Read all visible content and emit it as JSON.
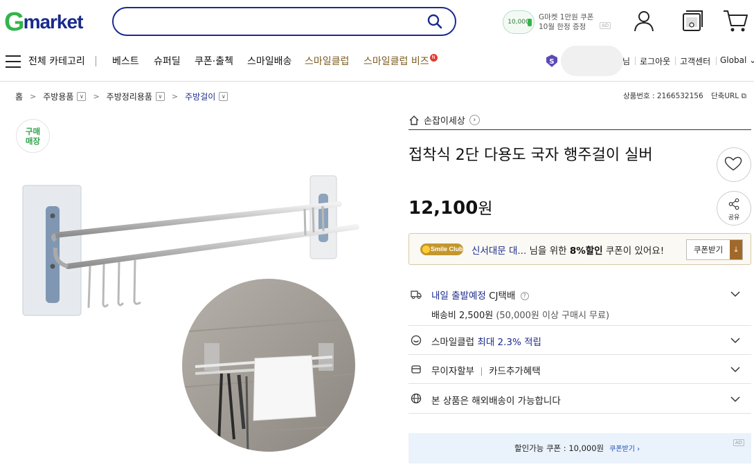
{
  "header": {
    "logo_g": "G",
    "logo_rest": "market",
    "search_value": "",
    "promo_badge": "10,000",
    "promo_line1": "G마켓 1만원 쿠폰",
    "promo_line2": "10월 한정 증정",
    "promo_ad": "AD"
  },
  "nav": {
    "all_categories": "전체 카테고리",
    "items": [
      "베스트",
      "슈퍼딜",
      "쿠폰·출첵",
      "스마일배송"
    ],
    "gold_items": [
      "스마일클럽",
      "스마일클럽 비즈"
    ],
    "new_badge": "N",
    "user_suffix": "님",
    "logout": "로그아웃",
    "customer_center": "고객센터",
    "global": "Global",
    "global_caret": "⌄"
  },
  "breadcrumb": {
    "home": "홈",
    "items": [
      "주방용품",
      "주방정리용품",
      "주방걸이"
    ],
    "product_no": "상품번호 : 2166532156",
    "short_url": "단축URL"
  },
  "product": {
    "buy_badge_line1": "구매",
    "buy_badge_line2": "매장",
    "seller": "손잡이세상",
    "title": "접착식 2단 다용도 국자 행주걸이 실버",
    "price_number": "12,100",
    "price_unit": "원",
    "share_label": "공유"
  },
  "coupon": {
    "logo": "Smile Club",
    "location": "신서대문 대...",
    "text_mid": " 님을 위한 ",
    "discount": "8%할인",
    "text_end": " 쿠폰이 있어요!",
    "button": "쿠폰받기"
  },
  "shipping": {
    "dispatch": "내일 출발예정",
    "carrier": "CJ택배",
    "fee": "배송비 2,500원",
    "free_condition": "(50,000원 이상 구매시 무료)"
  },
  "smileclub_row": {
    "label": "스마일클럽",
    "highlight": "최대 2.3% 적립"
  },
  "installment_row": {
    "label1": "무이자할부",
    "label2": "카드추가혜택"
  },
  "overseas_row": {
    "label": "본 상품은 해외배송이 가능합니다"
  },
  "bottom_coupon": {
    "text": "할인가능 쿠폰 : 10,000원",
    "link": "쿠폰받기 ›",
    "ad": "AD"
  },
  "colors": {
    "brand_green": "#33b44a",
    "brand_navy": "#1a2a8c",
    "club_gold": "#c4962c"
  }
}
